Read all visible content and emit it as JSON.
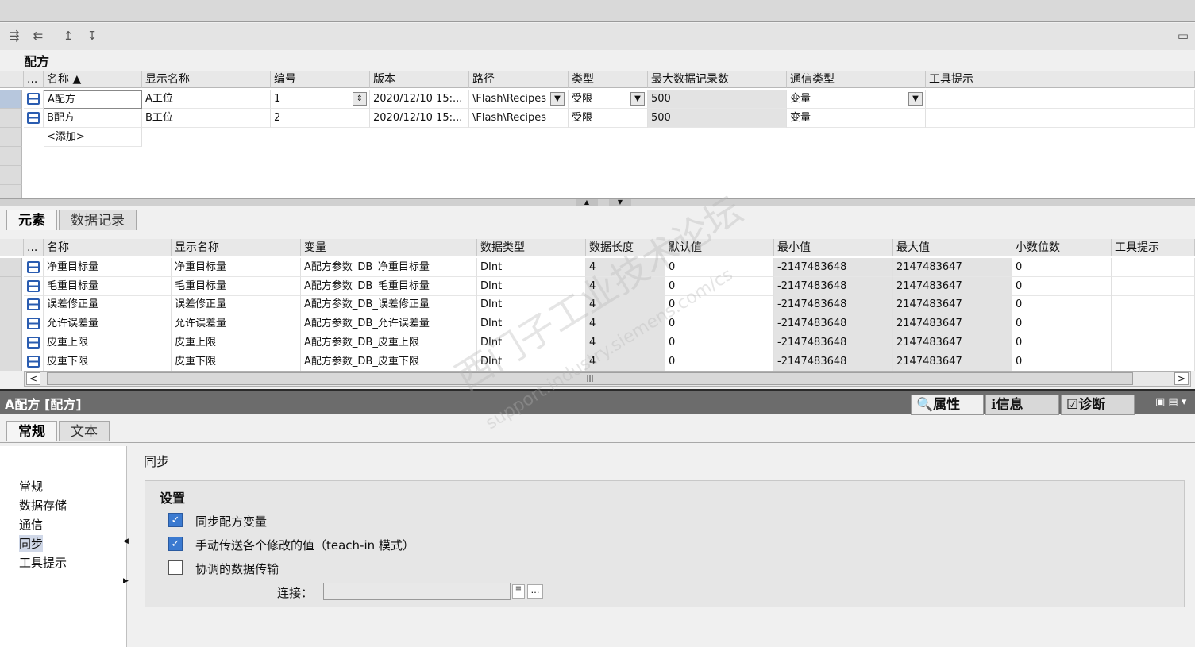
{
  "recipe_section": {
    "title": "配方",
    "columns": [
      "...",
      "名称 ▲",
      "显示名称",
      "编号",
      "版本",
      "路径",
      "类型",
      "最大数据记录数",
      "通信类型",
      "工具提示"
    ],
    "rows": [
      {
        "name": "A配方",
        "display": "A工位",
        "number": "1",
        "version": "2020/12/10 15:...",
        "path": "\\Flash\\Recipes",
        "type": "受限",
        "max": "500",
        "comm": "变量"
      },
      {
        "name": "B配方",
        "display": "B工位",
        "number": "2",
        "version": "2020/12/10 15:...",
        "path": "\\Flash\\Recipes",
        "type": "受限",
        "max": "500",
        "comm": "变量"
      }
    ],
    "add_label": "<添加>"
  },
  "element_tabs": {
    "elements": "元素",
    "records": "数据记录"
  },
  "element_section": {
    "columns": [
      "...",
      "名称",
      "显示名称",
      "变量",
      "数据类型",
      "数据长度",
      "默认值",
      "最小值",
      "最大值",
      "小数位数",
      "工具提示"
    ],
    "rows": [
      {
        "name": "净重目标量",
        "display": "净重目标量",
        "var": "A配方参数_DB_净重目标量",
        "dtype": "DInt",
        "len": "4",
        "def": "0",
        "min": "-2147483648",
        "max": "2147483647",
        "dec": "0"
      },
      {
        "name": "毛重目标量",
        "display": "毛重目标量",
        "var": "A配方参数_DB_毛重目标量",
        "dtype": "DInt",
        "len": "4",
        "def": "0",
        "min": "-2147483648",
        "max": "2147483647",
        "dec": "0"
      },
      {
        "name": "误差修正量",
        "display": "误差修正量",
        "var": "A配方参数_DB_误差修正量",
        "dtype": "DInt",
        "len": "4",
        "def": "0",
        "min": "-2147483648",
        "max": "2147483647",
        "dec": "0"
      },
      {
        "name": "允许误差量",
        "display": "允许误差量",
        "var": "A配方参数_DB_允许误差量",
        "dtype": "DInt",
        "len": "4",
        "def": "0",
        "min": "-2147483648",
        "max": "2147483647",
        "dec": "0"
      },
      {
        "name": "皮重上限",
        "display": "皮重上限",
        "var": "A配方参数_DB_皮重上限",
        "dtype": "DInt",
        "len": "4",
        "def": "0",
        "min": "-2147483648",
        "max": "2147483647",
        "dec": "0"
      },
      {
        "name": "皮重下限",
        "display": "皮重下限",
        "var": "A配方参数_DB_皮重下限",
        "dtype": "DInt",
        "len": "4",
        "def": "0",
        "min": "-2147483648",
        "max": "2147483647",
        "dec": "0"
      }
    ]
  },
  "inspector": {
    "title": "A配方 [配方]",
    "tabs": {
      "properties": "属性",
      "info": "信息",
      "diagnostics": "诊断"
    },
    "subtabs": {
      "general": "常规",
      "text": "文本"
    },
    "nav": [
      "常规",
      "数据存储",
      "通信",
      "同步",
      "工具提示"
    ],
    "section_heading": "同步",
    "settings_title": "设置",
    "check1": "同步配方变量",
    "check2": "手动传送各个修改的值（teach-in 模式）",
    "check3": "协调的数据传输",
    "connection_label": "连接：",
    "check1_checked": true,
    "check2_checked": true,
    "check3_checked": false
  },
  "watermark": "西门子工业技术论坛",
  "watermark_url": "support.industry.siemens.com/cs"
}
